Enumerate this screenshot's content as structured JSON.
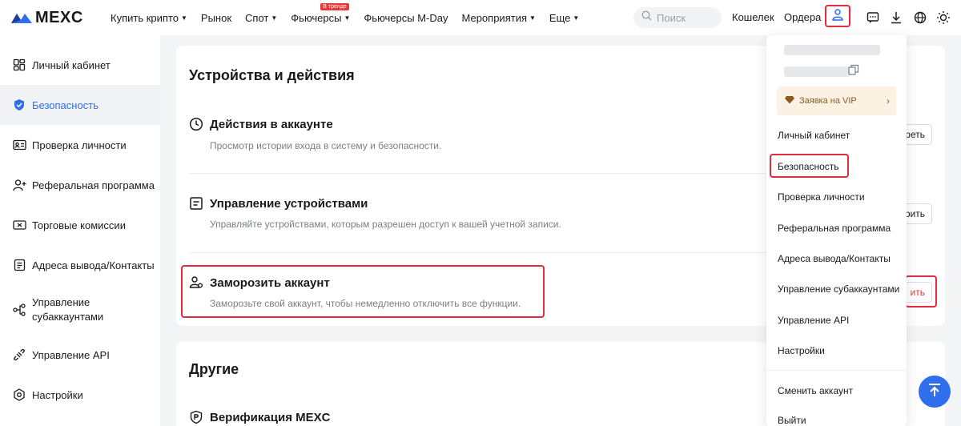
{
  "header": {
    "logo": "MEXC",
    "nav": [
      {
        "label": "Купить крипто",
        "caret": true
      },
      {
        "label": "Рынок",
        "caret": false
      },
      {
        "label": "Спот",
        "caret": true
      },
      {
        "label": "Фьючерсы",
        "caret": true,
        "badge": "В тренде"
      },
      {
        "label": "Фьючерсы M-Day",
        "caret": false
      },
      {
        "label": "Мероприятия",
        "caret": true
      },
      {
        "label": "Еще",
        "caret": true
      }
    ],
    "search_placeholder": "Поиск",
    "wallet": "Кошелек",
    "orders": "Ордера",
    "icons": [
      "user-icon",
      "chat-icon",
      "download-icon",
      "globe-icon",
      "theme-icon"
    ]
  },
  "sidebar": {
    "items": [
      {
        "label": "Личный кабинет",
        "icon": "dashboard-icon"
      },
      {
        "label": "Безопасность",
        "icon": "shield-icon",
        "active": true
      },
      {
        "label": "Проверка личности",
        "icon": "id-card-icon"
      },
      {
        "label": "Реферальная программа",
        "icon": "add-user-icon"
      },
      {
        "label": "Торговые комиссии",
        "icon": "ticket-icon"
      },
      {
        "label": "Адреса вывода/Контакты",
        "icon": "address-icon"
      },
      {
        "label": "Управление субаккаунтами",
        "icon": "subaccount-icon"
      },
      {
        "label": "Управление API",
        "icon": "api-icon"
      },
      {
        "label": "Настройки",
        "icon": "settings-icon"
      }
    ]
  },
  "main": {
    "devices_title": "Устройства и действия",
    "rows": [
      {
        "title": "Действия в аккаунте",
        "desc": "Просмотр истории входа в систему и безопасности.",
        "button": "реть"
      },
      {
        "title": "Управление устройствами",
        "desc": "Управляйте устройствами, которым разрешен доступ к вашей учетной записи.",
        "button": "рить"
      },
      {
        "title": "Заморозить аккаунт",
        "desc": "Заморозьте свой аккаунт, чтобы немедленно отключить все функции.",
        "button": "ить"
      }
    ],
    "other_title": "Другие",
    "other_row": "Верификация MEXC"
  },
  "dropdown": {
    "vip": "Заявка на VIP",
    "items": [
      "Личный кабинет",
      "Безопасность",
      "Проверка личности",
      "Реферальная программа",
      "Адреса вывода/Контакты",
      "Управление субаккаунтами",
      "Управление API",
      "Настройки"
    ],
    "switch_account": "Сменить аккаунт",
    "logout": "Выйти"
  },
  "colors": {
    "accent": "#2f6fed",
    "highlight": "#e02d3c",
    "danger": "#e53935"
  }
}
